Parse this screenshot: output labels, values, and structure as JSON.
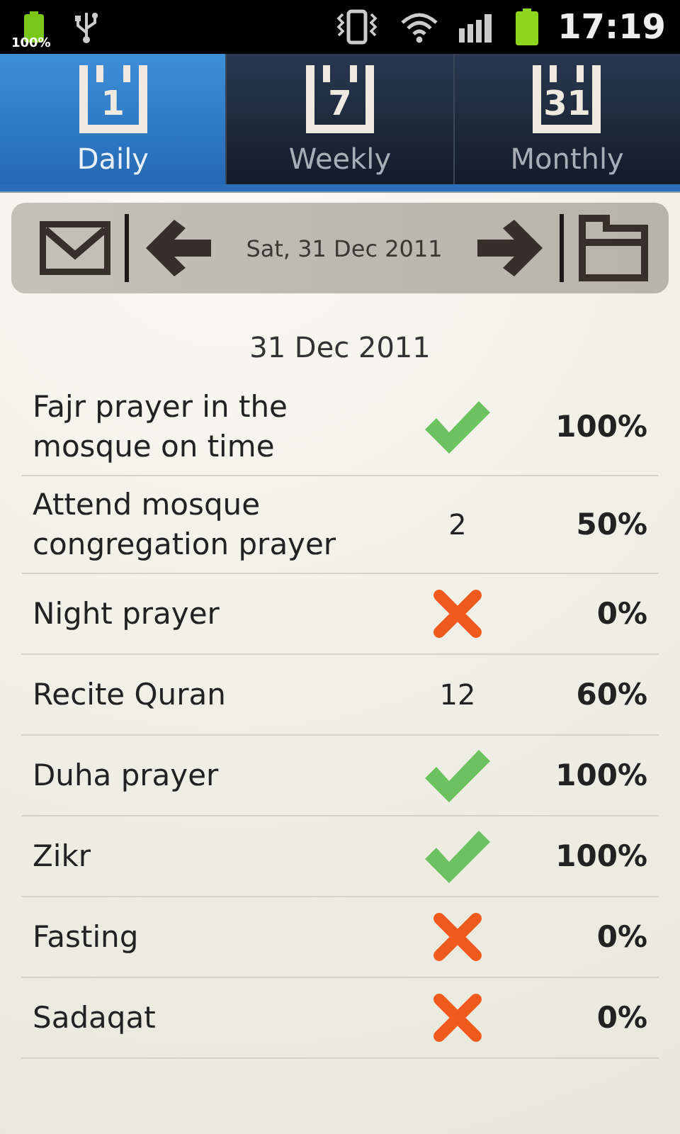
{
  "status_bar": {
    "battery_label": "100%",
    "time": "17:19"
  },
  "tabs": [
    {
      "label": "Daily",
      "icon_text": "1",
      "selected": true
    },
    {
      "label": "Weekly",
      "icon_text": "7",
      "selected": false
    },
    {
      "label": "Monthly",
      "icon_text": "31",
      "selected": false
    }
  ],
  "toolbar": {
    "date": "Sat, 31 Dec 2011"
  },
  "date_heading": "31 Dec 2011",
  "rows": [
    {
      "name": "Fajr prayer in the mosque on time",
      "kind": "check",
      "percent": "100%"
    },
    {
      "name": "Attend mosque congregation prayer",
      "kind": "count",
      "count": "2",
      "percent": "50%"
    },
    {
      "name": "Night prayer",
      "kind": "cross",
      "percent": "0%"
    },
    {
      "name": "Recite Quran",
      "kind": "count",
      "count": "12",
      "percent": "60%"
    },
    {
      "name": "Duha prayer",
      "kind": "check",
      "percent": "100%"
    },
    {
      "name": "Zikr",
      "kind": "check",
      "percent": "100%"
    },
    {
      "name": "Fasting",
      "kind": "cross",
      "percent": "0%"
    },
    {
      "name": "Sadaqat",
      "kind": "cross",
      "percent": "0%"
    }
  ]
}
